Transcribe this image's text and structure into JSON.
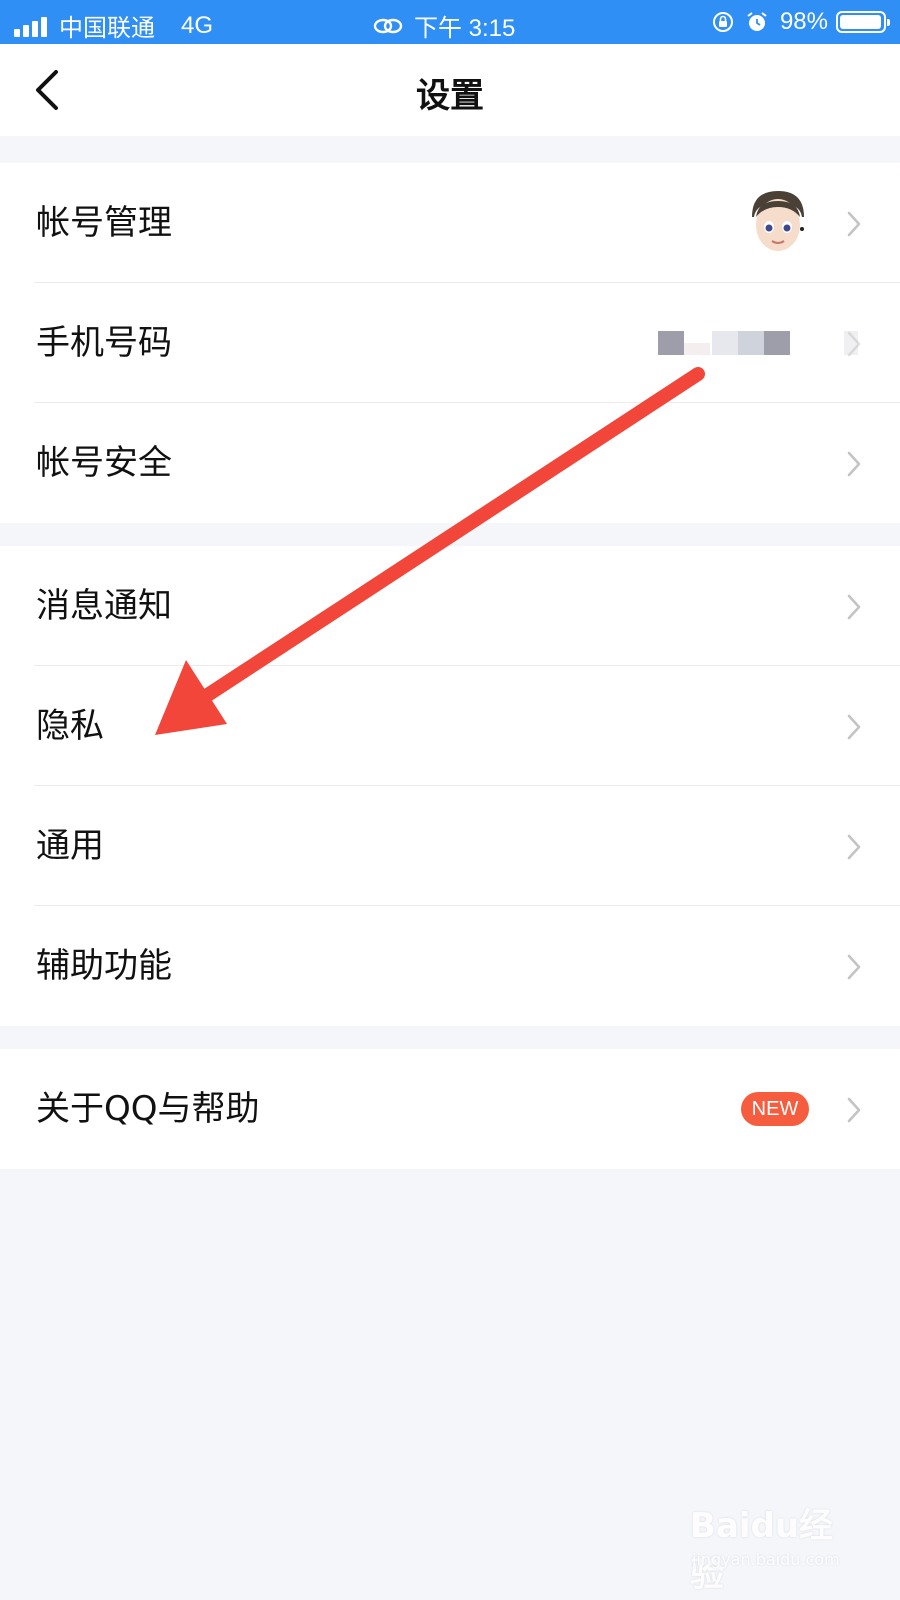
{
  "status_bar": {
    "carrier": "中国联通",
    "network": "4G",
    "time": "下午 3:15",
    "battery": "98%",
    "battery_level": 0.98,
    "background_color": "#2f8ff5"
  },
  "nav": {
    "title": "设置",
    "back_icon": "chevron-left-icon"
  },
  "groups": [
    {
      "items": [
        {
          "label": "帐号管理",
          "accessory": "avatar"
        },
        {
          "label": "手机号码",
          "accessory": "masked-value"
        },
        {
          "label": "帐号安全"
        }
      ]
    },
    {
      "items": [
        {
          "label": "消息通知"
        },
        {
          "label": "隐私"
        },
        {
          "label": "通用"
        },
        {
          "label": "辅助功能"
        }
      ]
    },
    {
      "items": [
        {
          "label": "关于QQ与帮助",
          "badge": "NEW"
        }
      ]
    }
  ],
  "colors": {
    "page_background": "#f5f6fa",
    "badge": "#f55d3e",
    "annotation_arrow": "#f2463a",
    "chevron": "#c4c4c4"
  },
  "watermark": {
    "brand": "Baidu经验",
    "url": "jingyan.baidu.com"
  }
}
